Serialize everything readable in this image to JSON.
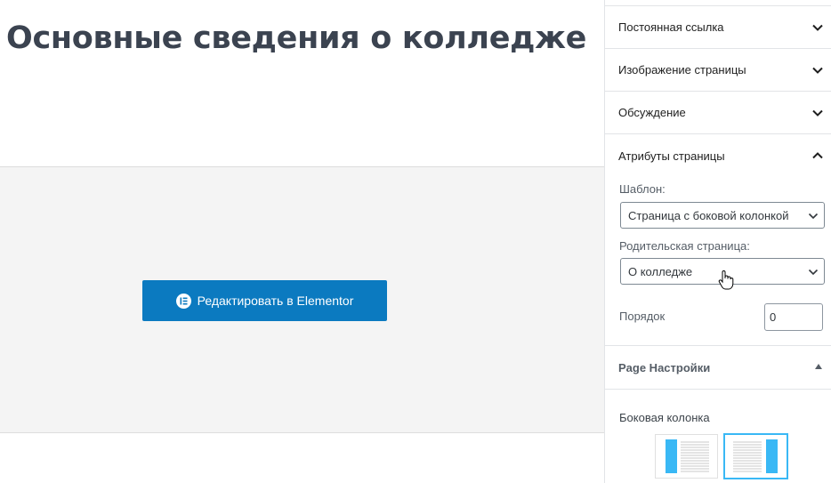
{
  "editor": {
    "page_title": "Основные сведения о колледже",
    "elementor_button": "Редактировать в Elementor"
  },
  "sidebar": {
    "panels": [
      {
        "label": "Постоянная ссылка",
        "state": "collapsed"
      },
      {
        "label": "Изображение страницы",
        "state": "collapsed"
      },
      {
        "label": "Обсуждение",
        "state": "collapsed"
      },
      {
        "label": "Атрибуты страницы",
        "state": "expanded"
      }
    ],
    "attributes": {
      "template_label": "Шаблон:",
      "template_value": "Страница с боковой колонкой",
      "parent_label": "Родительская страница:",
      "parent_value": "О колледже",
      "order_label": "Порядок",
      "order_value": "0"
    },
    "page_settings": {
      "title": "Page Настройки",
      "sidebar_label": "Боковая колонка",
      "layouts": [
        "left-sidebar",
        "right-sidebar"
      ],
      "selected_layout": "right-sidebar"
    }
  },
  "colors": {
    "accent": "#0b7ac0",
    "thumb_blue": "#39b8f5",
    "title": "#3b4350"
  }
}
